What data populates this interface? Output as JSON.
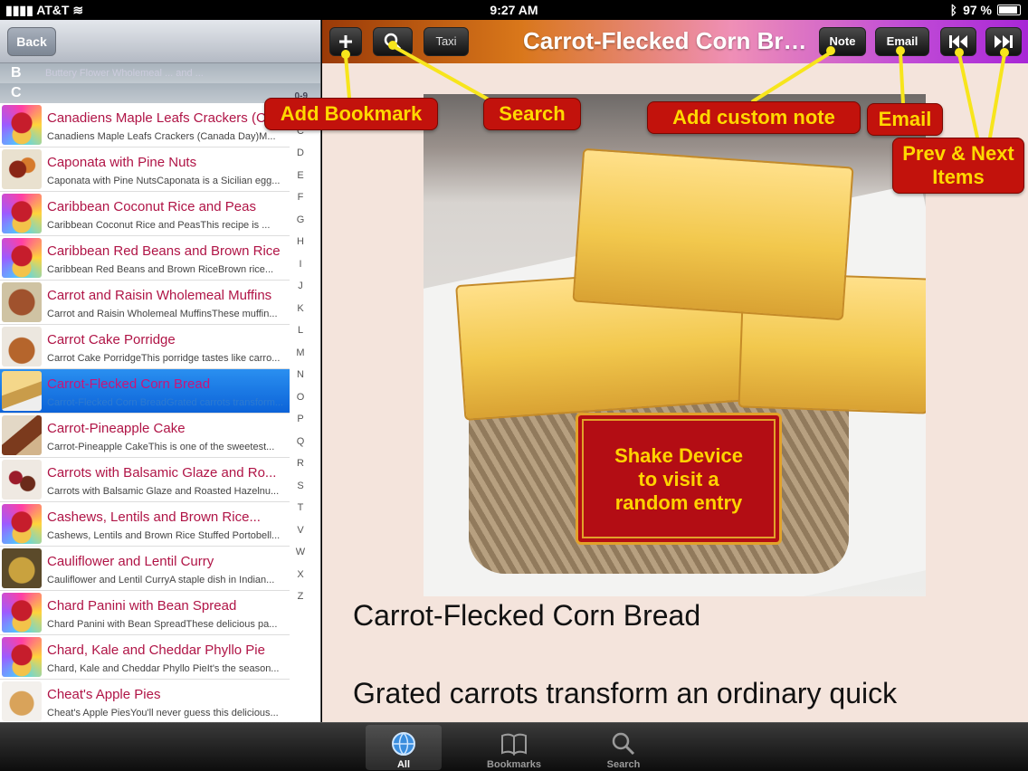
{
  "status_bar": {
    "carrier": "AT&T",
    "time": "9:27 AM",
    "battery": "97 %"
  },
  "sidebar": {
    "back_label": "Back",
    "section_b": "B",
    "section_b_ghost": "Buttery Flower Wholemeal ... and ...",
    "section_c": "C",
    "index_top": "0-9",
    "index": [
      "B",
      "C",
      "D",
      "E",
      "F",
      "G",
      "H",
      "I",
      "J",
      "K",
      "L",
      "M",
      "N",
      "O",
      "P",
      "Q",
      "R",
      "S",
      "T",
      "V",
      "W",
      "X",
      "Z"
    ],
    "items": [
      {
        "title": "Canadiens Maple Leafs Crackers (C...",
        "subtitle": "Canadiens Maple Leafs Crackers (Canada Day)M...",
        "thumb": "muffin"
      },
      {
        "title": "Caponata with Pine Nuts",
        "subtitle": "Caponata with Pine NutsCaponata is a Sicilian egg...",
        "thumb": "food1"
      },
      {
        "title": "Caribbean Coconut Rice and Peas",
        "subtitle": "Caribbean Coconut Rice and PeasThis recipe is ...",
        "thumb": "muffin"
      },
      {
        "title": "Caribbean Red Beans and Brown Rice",
        "subtitle": "Caribbean Red Beans and Brown RiceBrown rice...",
        "thumb": "muffin"
      },
      {
        "title": "Carrot and Raisin Wholemeal Muffins",
        "subtitle": "Carrot and Raisin Wholemeal MuffinsThese muffin...",
        "thumb": "food2"
      },
      {
        "title": "Carrot Cake Porridge",
        "subtitle": "Carrot Cake PorridgeThis porridge tastes like carro...",
        "thumb": "food3"
      },
      {
        "title": "Carrot-Flecked Corn Bread",
        "subtitle": "Carrot-Flecked Corn BreadGrated carrots transform...",
        "thumb": "food4",
        "selected": true
      },
      {
        "title": "Carrot-Pineapple Cake",
        "subtitle": "Carrot-Pineapple CakeThis is one of the sweetest...",
        "thumb": "food5"
      },
      {
        "title": "Carrots with Balsamic Glaze and Ro...",
        "subtitle": "Carrots with Balsamic Glaze and Roasted Hazelnu...",
        "thumb": "food6"
      },
      {
        "title": "Cashews, Lentils and Brown Rice...",
        "subtitle": "Cashews, Lentils and Brown Rice Stuffed Portobell...",
        "thumb": "muffin"
      },
      {
        "title": "Cauliflower and Lentil Curry",
        "subtitle": "Cauliflower and Lentil CurryA staple dish in Indian...",
        "thumb": "food7"
      },
      {
        "title": "Chard Panini with Bean Spread",
        "subtitle": "Chard Panini with Bean SpreadThese delicious pa...",
        "thumb": "muffin"
      },
      {
        "title": "Chard, Kale and Cheddar Phyllo Pie",
        "subtitle": "Chard, Kale and Cheddar Phyllo PieIt's the season...",
        "thumb": "muffin"
      },
      {
        "title": "Cheat's Apple Pies",
        "subtitle": "Cheat's Apple PiesYou'll never guess this delicious...",
        "thumb": "food8"
      }
    ]
  },
  "toolbar": {
    "taxi_label": "Taxi",
    "title": "Carrot-Flecked Corn Bread",
    "note_label": "Note",
    "email_label": "Email"
  },
  "content": {
    "heading": "Carrot-Flecked Corn Bread",
    "body": "Grated carrots transform an ordinary quick"
  },
  "callouts": {
    "add_bookmark": "Add Bookmark",
    "search": "Search",
    "add_note": "Add custom note",
    "email": "Email",
    "prev_next_1": "Prev & Next",
    "prev_next_2": "Items",
    "shake_1": "Shake Device",
    "shake_2": "to visit a",
    "shake_3": "random entry"
  },
  "tabbar": {
    "tabs": [
      {
        "label": "All",
        "icon": "globe-icon",
        "active": true
      },
      {
        "label": "Bookmarks",
        "icon": "book-icon"
      },
      {
        "label": "Search",
        "icon": "magnifier-icon"
      }
    ]
  },
  "colors": {
    "callout_bg": "#c2120c",
    "callout_text": "#ffd800",
    "list_title": "#b01446",
    "selection": "#0c63d8"
  }
}
